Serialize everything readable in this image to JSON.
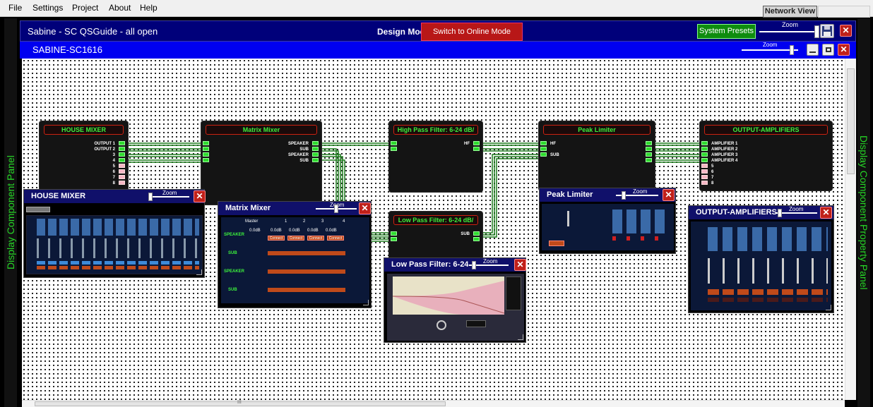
{
  "menu": {
    "file": "File",
    "settings": "Settings",
    "project": "Project",
    "about": "About",
    "help": "Help"
  },
  "network_view": "Network View",
  "side_left": "Display Component Panel",
  "side_right": "Display Component Property Panel",
  "header": {
    "project_title": "Sabine - SC QSGuide - all open",
    "mode_label": "Design Mode",
    "switch_button": "Switch to Online Mode",
    "system_presets": "System Presets",
    "zoom": "Zoom",
    "device_name": "SABINE-SC1616"
  },
  "blocks": {
    "house_mixer": {
      "title": "HOUSE MIXER",
      "outputs": [
        "OUTPUT 1",
        "OUTPUT 2",
        "3",
        "4",
        "5",
        "6",
        "7",
        "8"
      ]
    },
    "matrix_mixer": {
      "title": "Matrix Mixer",
      "outputs": [
        "SPEAKER",
        "SUB",
        "SPEAKER",
        "SUB"
      ]
    },
    "hpf": {
      "title": "High Pass Filter: 6-24 dB/",
      "outputs": [
        "HF"
      ]
    },
    "lpf": {
      "title": "Low Pass Filter: 6-24 dB/",
      "outputs": [
        "SUB"
      ]
    },
    "peak_limiter": {
      "title": "Peak Limiter",
      "inputs": [
        "HF",
        "SUB"
      ]
    },
    "output_amplifiers": {
      "title": "OUTPUT-AMPLIFIERS",
      "inputs": [
        "AMPLIFIER 1",
        "AMPLIFIER 2",
        "AMPLIFIER 3",
        "AMPLIFIER 4",
        "5",
        "6",
        "7",
        "8"
      ]
    }
  },
  "windows": {
    "house_mixer": {
      "title": "HOUSE MIXER",
      "zoom": "Zoom",
      "close": "X"
    },
    "matrix_mixer": {
      "title": "Matrix Mixer",
      "zoom": "Zoom",
      "close": "X",
      "columns": [
        "Master",
        "1",
        "2",
        "3",
        "4"
      ],
      "rows": [
        "SPEAKER",
        "SUB",
        "SPEAKER",
        "SUB"
      ],
      "cell_value": "0.0dB",
      "connect": "Connect"
    },
    "peak_limiter": {
      "title": "Peak Limiter",
      "zoom": "Zoom",
      "close": "X"
    },
    "lpf": {
      "title": "Low Pass Filter: 6-24",
      "zoom": "Zoom",
      "close": "X"
    },
    "output_amplifiers": {
      "title": "OUTPUT-AMPLIFIERS",
      "zoom": "Zoom",
      "close": "X"
    }
  },
  "scrollbar": {
    "h_thumb_grip": "III"
  },
  "colors": {
    "titlebar_dark": "#00007a",
    "titlebar_bright": "#0000f0",
    "wire": "#2edb2e",
    "alert_red": "#c0201a"
  }
}
